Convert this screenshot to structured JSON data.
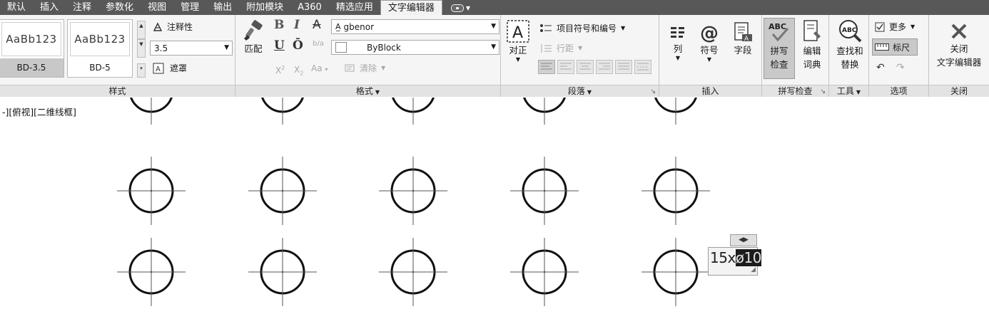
{
  "tabs": [
    "默认",
    "插入",
    "注释",
    "参数化",
    "视图",
    "管理",
    "输出",
    "附加模块",
    "A360",
    "精选应用",
    "文字编辑器"
  ],
  "active_tab": "文字编辑器",
  "ribbon": {
    "style_panel": {
      "title": "样式",
      "styles": [
        {
          "sample": "AaBb123",
          "name": "BD-3.5"
        },
        {
          "sample": "AaBb123",
          "name": "BD-5"
        }
      ],
      "annotative_label": "注释性",
      "text_height": "3.5",
      "mask_label": "遮罩"
    },
    "format_panel": {
      "title": "格式",
      "match_label": "匹配",
      "bold": "B",
      "italic": "I",
      "strike": "A",
      "underline": "U",
      "overline": "Ō",
      "stack": "b/a",
      "superscript": "X",
      "subscript": "X",
      "case": "Aa",
      "font": "gbenor",
      "color": "ByBlock",
      "clear_label": "清除"
    },
    "paragraph_panel": {
      "title": "段落",
      "justify_label": "对正",
      "bullets_label": "项目符号和编号",
      "line_spacing_label": "行距"
    },
    "insert_panel": {
      "title": "插入",
      "columns_label": "列",
      "symbol_label": "符号",
      "field_label": "字段"
    },
    "spell_panel": {
      "title": "拼写检查",
      "spellcheck_line1": "拼写",
      "spellcheck_line2": "检查",
      "dict_line1": "编辑",
      "dict_line2": "词典"
    },
    "tools_panel": {
      "title": "工具",
      "find_line1": "查找和",
      "find_line2": "替换"
    },
    "options_panel": {
      "title": "选项",
      "more_label": "更多",
      "ruler_label": "标尺"
    },
    "close_panel": {
      "title": "关闭",
      "close_line1": "关闭",
      "close_line2": "文字编辑器"
    }
  },
  "viewport": {
    "label": "-][俯视][二维线框]"
  },
  "text_editor": {
    "prefix": "15x",
    "selected": "ø10"
  },
  "colors": {
    "tabbar": "#585858",
    "ribbon": "#f5f5f5",
    "panel_title": "#e3e3e3",
    "selected_tool": "#c9c9c9"
  }
}
